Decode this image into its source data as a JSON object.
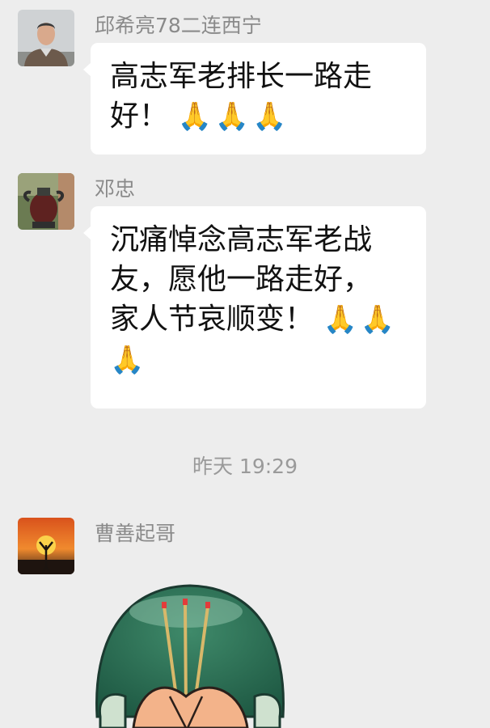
{
  "messages": [
    {
      "sender": "邱希亮78二连西宁",
      "text": "高志军老排长一路走好！",
      "emoji": "🙏🙏🙏"
    },
    {
      "sender": "邓忠",
      "text_line1": "沉痛悼念高志军老战",
      "text_line2": "友，愿他一路走好，",
      "text_line3": "家人节哀顺变！",
      "emoji_line3": "🙏🙏",
      "emoji_line4": "🙏"
    }
  ],
  "timestamp": "昨天 19:29",
  "third": {
    "sender": "曹善起哥",
    "sticker": "praying-incense-sticker"
  },
  "colors": {
    "background": "#ededed",
    "bubble": "#ffffff",
    "sender_text": "#8a8a8a",
    "message_text": "#111111"
  }
}
